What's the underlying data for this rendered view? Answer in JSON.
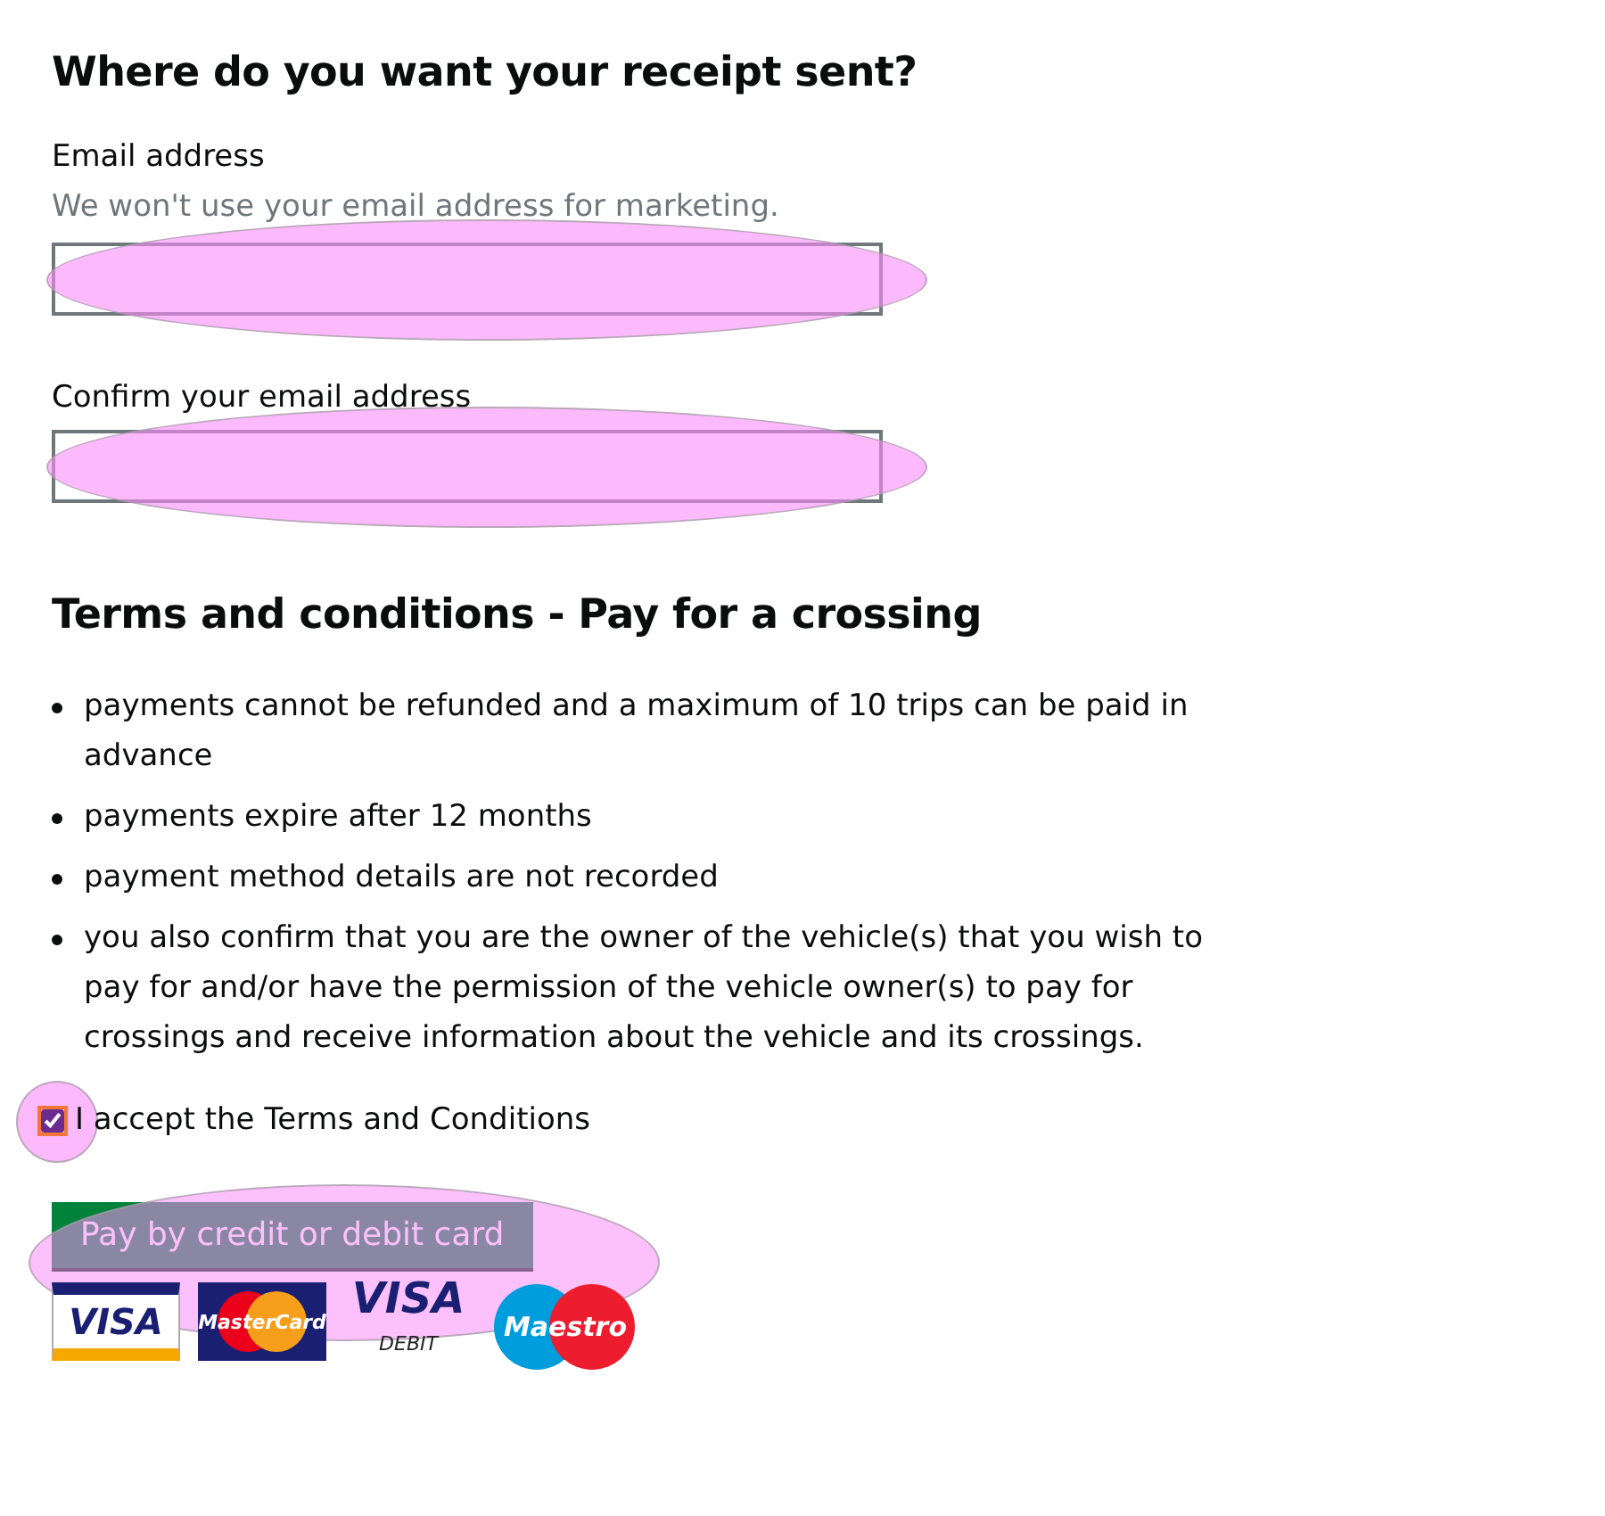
{
  "receipt": {
    "heading": "Where do you want your receipt sent?",
    "fields": [
      {
        "label": "Email address",
        "hint": "We won't use your email address for marketing."
      },
      {
        "label": "Confirm your email address"
      }
    ]
  },
  "terms": {
    "heading": "Terms and conditions - Pay for a crossing",
    "items": [
      "payments cannot be refunded and a maximum of 10 trips can be paid in advance",
      "payments expire after 12 months",
      "payment method details are not recorded",
      "you also confirm that you are the owner of the vehicle(s) that you wish to pay for and/or have the permission of the vehicle owner(s) to pay for crossings and receive information about the vehicle and its crossings."
    ],
    "accept": {
      "label": "I accept the Terms and Conditions",
      "checked": true
    }
  },
  "pay_button": {
    "label": "Pay by credit or debit card"
  },
  "cards": [
    {
      "kind": "visa",
      "label": "VISA"
    },
    {
      "kind": "mastercard",
      "label": "MasterCard"
    },
    {
      "kind": "visa_debit",
      "label": "VISA",
      "sublabel": "DEBIT"
    },
    {
      "kind": "maestro",
      "label": "Maestro"
    }
  ]
}
